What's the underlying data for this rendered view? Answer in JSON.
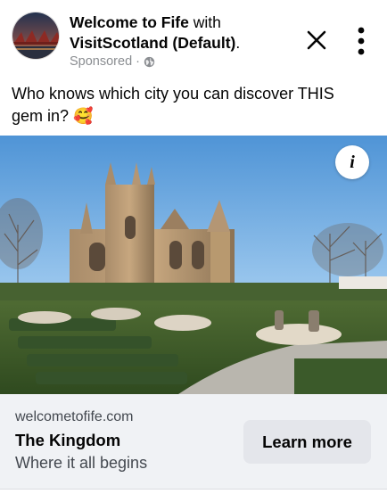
{
  "post": {
    "page_name": "Welcome to Fife",
    "with_text": " with ",
    "partner_name": "VisitScotland (Default)",
    "trailing": ".",
    "sponsored_label": "Sponsored",
    "separator": " · ",
    "privacy_icon": "globe-icon",
    "body_text": "Who knows which city you can discover THIS gem in? 🥰"
  },
  "controls": {
    "close_icon": "close-icon",
    "more_icon": "more-vertical-icon",
    "info_icon": "info-icon",
    "info_glyph": "i"
  },
  "link_card": {
    "domain": "welcometofife.com",
    "headline": "The Kingdom",
    "description": "Where it all begins",
    "cta_label": "Learn more"
  },
  "colors": {
    "text_primary": "#050505",
    "text_secondary": "#8a8d91",
    "footer_bg": "#f0f2f5",
    "cta_bg": "#e4e6eb",
    "sky": "#7fb6e6"
  }
}
